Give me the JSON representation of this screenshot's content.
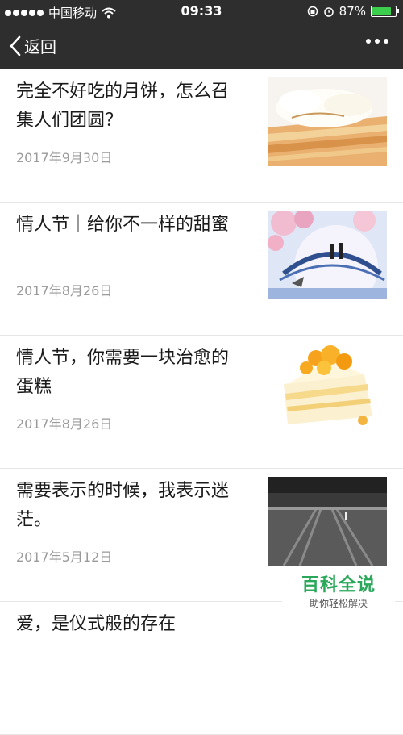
{
  "status_bar": {
    "carrier": "中国移动",
    "time": "09:33",
    "battery": "87%"
  },
  "nav": {
    "back_label": "返回"
  },
  "articles": [
    {
      "title": "完全不好吃的月饼，怎么召集人们团圆？",
      "date": "2017年9月30日"
    },
    {
      "title": "情人节｜给你不一样的甜蜜",
      "date": "2017年8月26日"
    },
    {
      "title": "情人节，你需要一块治愈的蛋糕",
      "date": "2017年8月26日"
    },
    {
      "title": "需要表示的时候，我表示迷茫。",
      "date": "2017年5月12日"
    },
    {
      "title": "爱，是仪式般的存在",
      "date": ""
    }
  ],
  "watermark": {
    "main": "百科全说",
    "sub": "助你轻松解决"
  }
}
